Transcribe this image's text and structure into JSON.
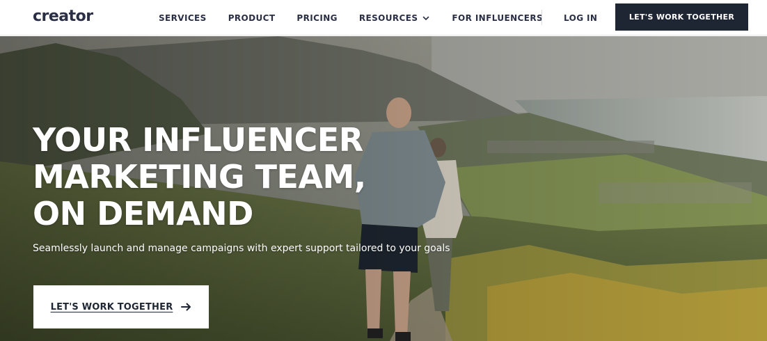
{
  "nav": {
    "logo": "creator",
    "links": [
      {
        "label": "SERVICES"
      },
      {
        "label": "PRODUCT"
      },
      {
        "label": "PRICING"
      },
      {
        "label": "RESOURCES"
      },
      {
        "label": "FOR INFLUENCERS"
      }
    ],
    "login": "LOG IN",
    "cta": "LET'S WORK TOGETHER"
  },
  "hero": {
    "headline": [
      "YOUR INFLUENCER",
      "MARKETING TEAM,",
      "ON DEMAND"
    ],
    "subline": "Seamlessly launch and manage campaigns with expert support tailored to your goals",
    "cta": "LET'S WORK TOGETHER"
  },
  "icons": {
    "resources_dropdown": "chevron-down-icon",
    "cta_arrow": "arrow-right-icon"
  },
  "colors": {
    "nav_bg": "#ffffff",
    "text_dark": "#1f2633",
    "cta_dark_bg": "#1f2633",
    "logo_accent": "#ff5a36"
  }
}
